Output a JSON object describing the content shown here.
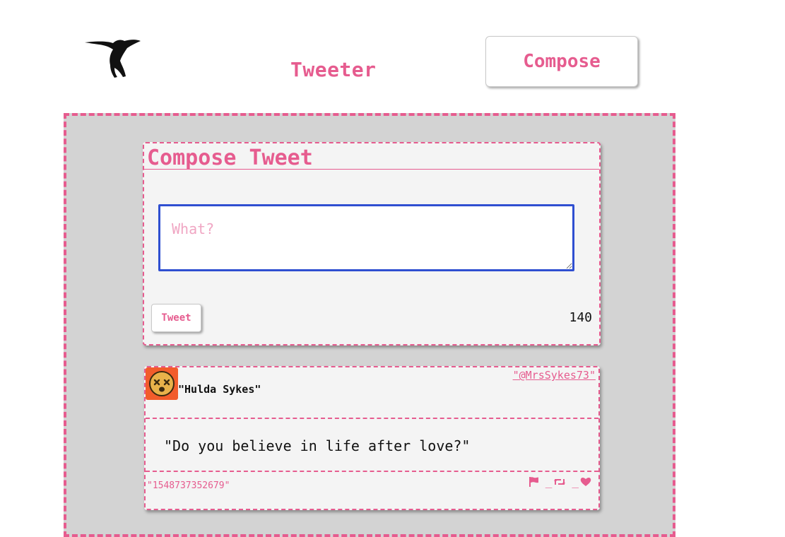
{
  "header": {
    "app_title": "Tweeter",
    "compose_label": "Compose",
    "logo_icon": "hummingbird-icon"
  },
  "compose": {
    "heading": "Compose Tweet",
    "placeholder": "What?",
    "value": "",
    "button_label": "Tweet",
    "char_count": "140"
  },
  "tweets": [
    {
      "name": "\"Hulda Sykes\"",
      "handle": "\"@MrsSykes73\"",
      "text": "\"Do you believe in life after love?\"",
      "timestamp": "\"1548737352679\"",
      "avatar_icon": "dizzy-face-icon",
      "actions": [
        "flag-icon",
        "retweet-icon",
        "heart-icon"
      ],
      "separators": [
        "_",
        "_"
      ]
    }
  ],
  "colors": {
    "accent": "#e65c8f",
    "panel_bg": "#f4f4f4",
    "main_bg": "#d3d3d3",
    "avatar_bg": "#f25c2b",
    "avatar_face": "#e8b24a",
    "input_focus": "#2f4fd1"
  }
}
